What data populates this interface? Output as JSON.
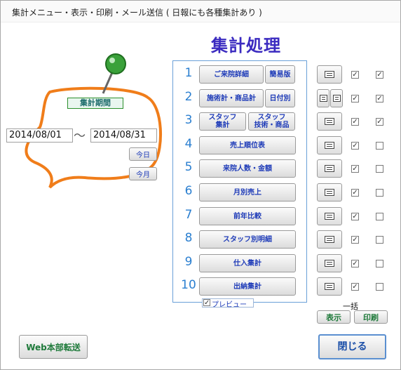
{
  "window": {
    "title": "集計メニュー・表示・印刷・メール送信 ( 日報にも各種集計あり )"
  },
  "heading": "集計処理",
  "period": {
    "label": "集計期間",
    "from": "2014/08/01",
    "separator": "～",
    "to": "2014/08/31",
    "today_label": "今日",
    "this_month_label": "今月"
  },
  "menu": [
    {
      "num": "1",
      "buttons": [
        [
          "ご来院詳細"
        ],
        [
          "簡易版"
        ]
      ],
      "print_buttons": 1,
      "show_checked": true,
      "print_checked": true
    },
    {
      "num": "2",
      "buttons": [
        [
          "施術計・商品計"
        ],
        [
          "日付別"
        ]
      ],
      "print_buttons": 2,
      "show_checked": true,
      "print_checked": true
    },
    {
      "num": "3",
      "buttons": [
        [
          "スタッフ",
          "集計"
        ],
        [
          "スタッフ",
          "技術・商品"
        ]
      ],
      "print_buttons": 1,
      "show_checked": true,
      "print_checked": true
    },
    {
      "num": "4",
      "buttons": [
        [
          "売上順位表"
        ]
      ],
      "print_buttons": 1,
      "show_checked": true,
      "print_checked": false
    },
    {
      "num": "5",
      "buttons": [
        [
          "来院人数・金額"
        ]
      ],
      "print_buttons": 1,
      "show_checked": true,
      "print_checked": false
    },
    {
      "num": "6",
      "buttons": [
        [
          "月別売上"
        ]
      ],
      "print_buttons": 1,
      "show_checked": true,
      "print_checked": false
    },
    {
      "num": "7",
      "buttons": [
        [
          "前年比較"
        ]
      ],
      "print_buttons": 1,
      "show_checked": true,
      "print_checked": false
    },
    {
      "num": "8",
      "buttons": [
        [
          "スタッフ別明細"
        ]
      ],
      "print_buttons": 1,
      "show_checked": true,
      "print_checked": false
    },
    {
      "num": "9",
      "buttons": [
        [
          "仕入集計"
        ]
      ],
      "print_buttons": 1,
      "show_checked": true,
      "print_checked": false
    },
    {
      "num": "10",
      "buttons": [
        [
          "出納集計"
        ]
      ],
      "print_buttons": 1,
      "show_checked": true,
      "print_checked": false
    }
  ],
  "preview": {
    "label": "プレビュー",
    "checked": true
  },
  "bulk": {
    "label": "一括",
    "show_label": "表示",
    "print_label": "印刷"
  },
  "web_transfer_label": "Web本部転送",
  "close_label": "閉じる",
  "icons": {
    "pushpin": "pushpin-icon",
    "print": "printer-icon"
  },
  "colors": {
    "heading": "#3b2bc0",
    "button_text": "#1e3bb8",
    "number": "#2b7fd0",
    "bubble_stroke": "#f07d1a",
    "pin": "#3aa13a"
  }
}
